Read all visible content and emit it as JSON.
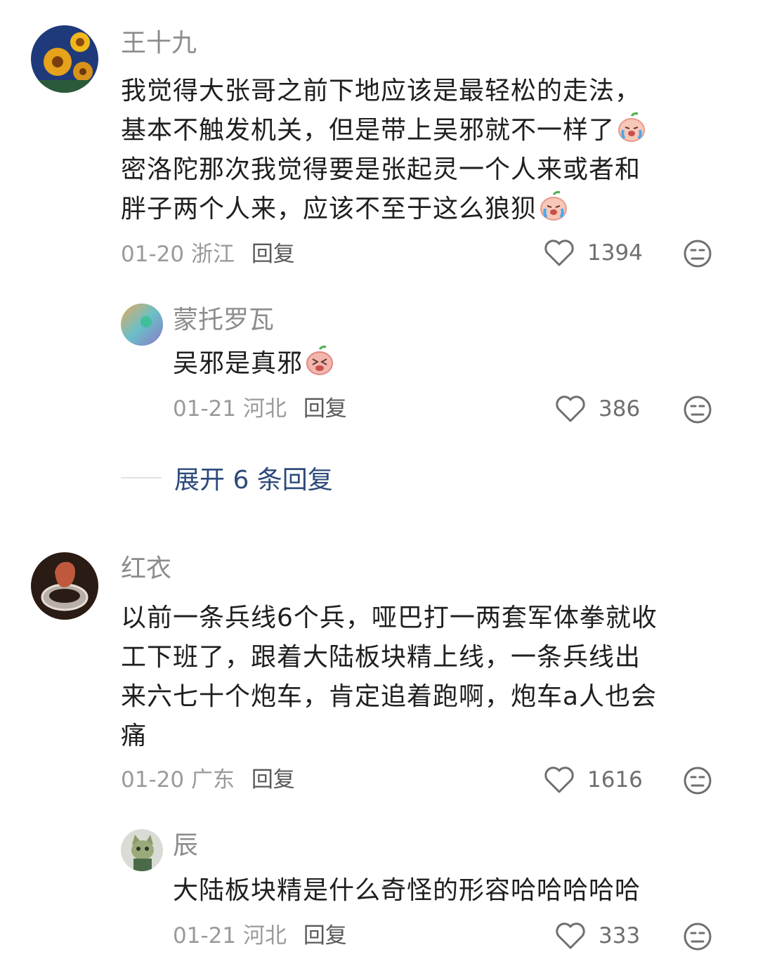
{
  "comments": [
    {
      "username": "王十九",
      "lines": [
        "我觉得大张哥之前下地应该是最轻松的走法，",
        "基本不触发机关，但是带上吴邪就不一样了",
        "密洛陀那次我觉得要是张起灵一个人来或者和",
        "胖子两个人来，应该不至于这么狼狈"
      ],
      "date": "01-20",
      "location": "浙江",
      "reply_label": "回复",
      "likes": "1394",
      "reply": {
        "username": "蒙托罗瓦",
        "text": "吴邪是真邪",
        "date": "01-21",
        "location": "河北",
        "reply_label": "回复",
        "likes": "386"
      },
      "expand_label": "展开 6 条回复"
    },
    {
      "username": "红衣",
      "lines": [
        "以前一条兵线6个兵，哑巴打一两套军体拳就收",
        "工下班了，跟着大陆板块精上线，一条兵线出",
        "来六七十个炮车，肯定追着跑啊，炮车a人也会",
        "痛"
      ],
      "date": "01-20",
      "location": "广东",
      "reply_label": "回复",
      "likes": "1616",
      "reply": {
        "username": "辰",
        "text": "大陆板块精是什么奇怪的形容哈哈哈哈哈",
        "date": "01-21",
        "location": "河北",
        "reply_label": "回复",
        "likes": "333"
      }
    }
  ],
  "icons": {
    "like": "heart-outline-icon",
    "dislike": "meh-face-icon",
    "emoji": "crying-peach-emoji"
  }
}
